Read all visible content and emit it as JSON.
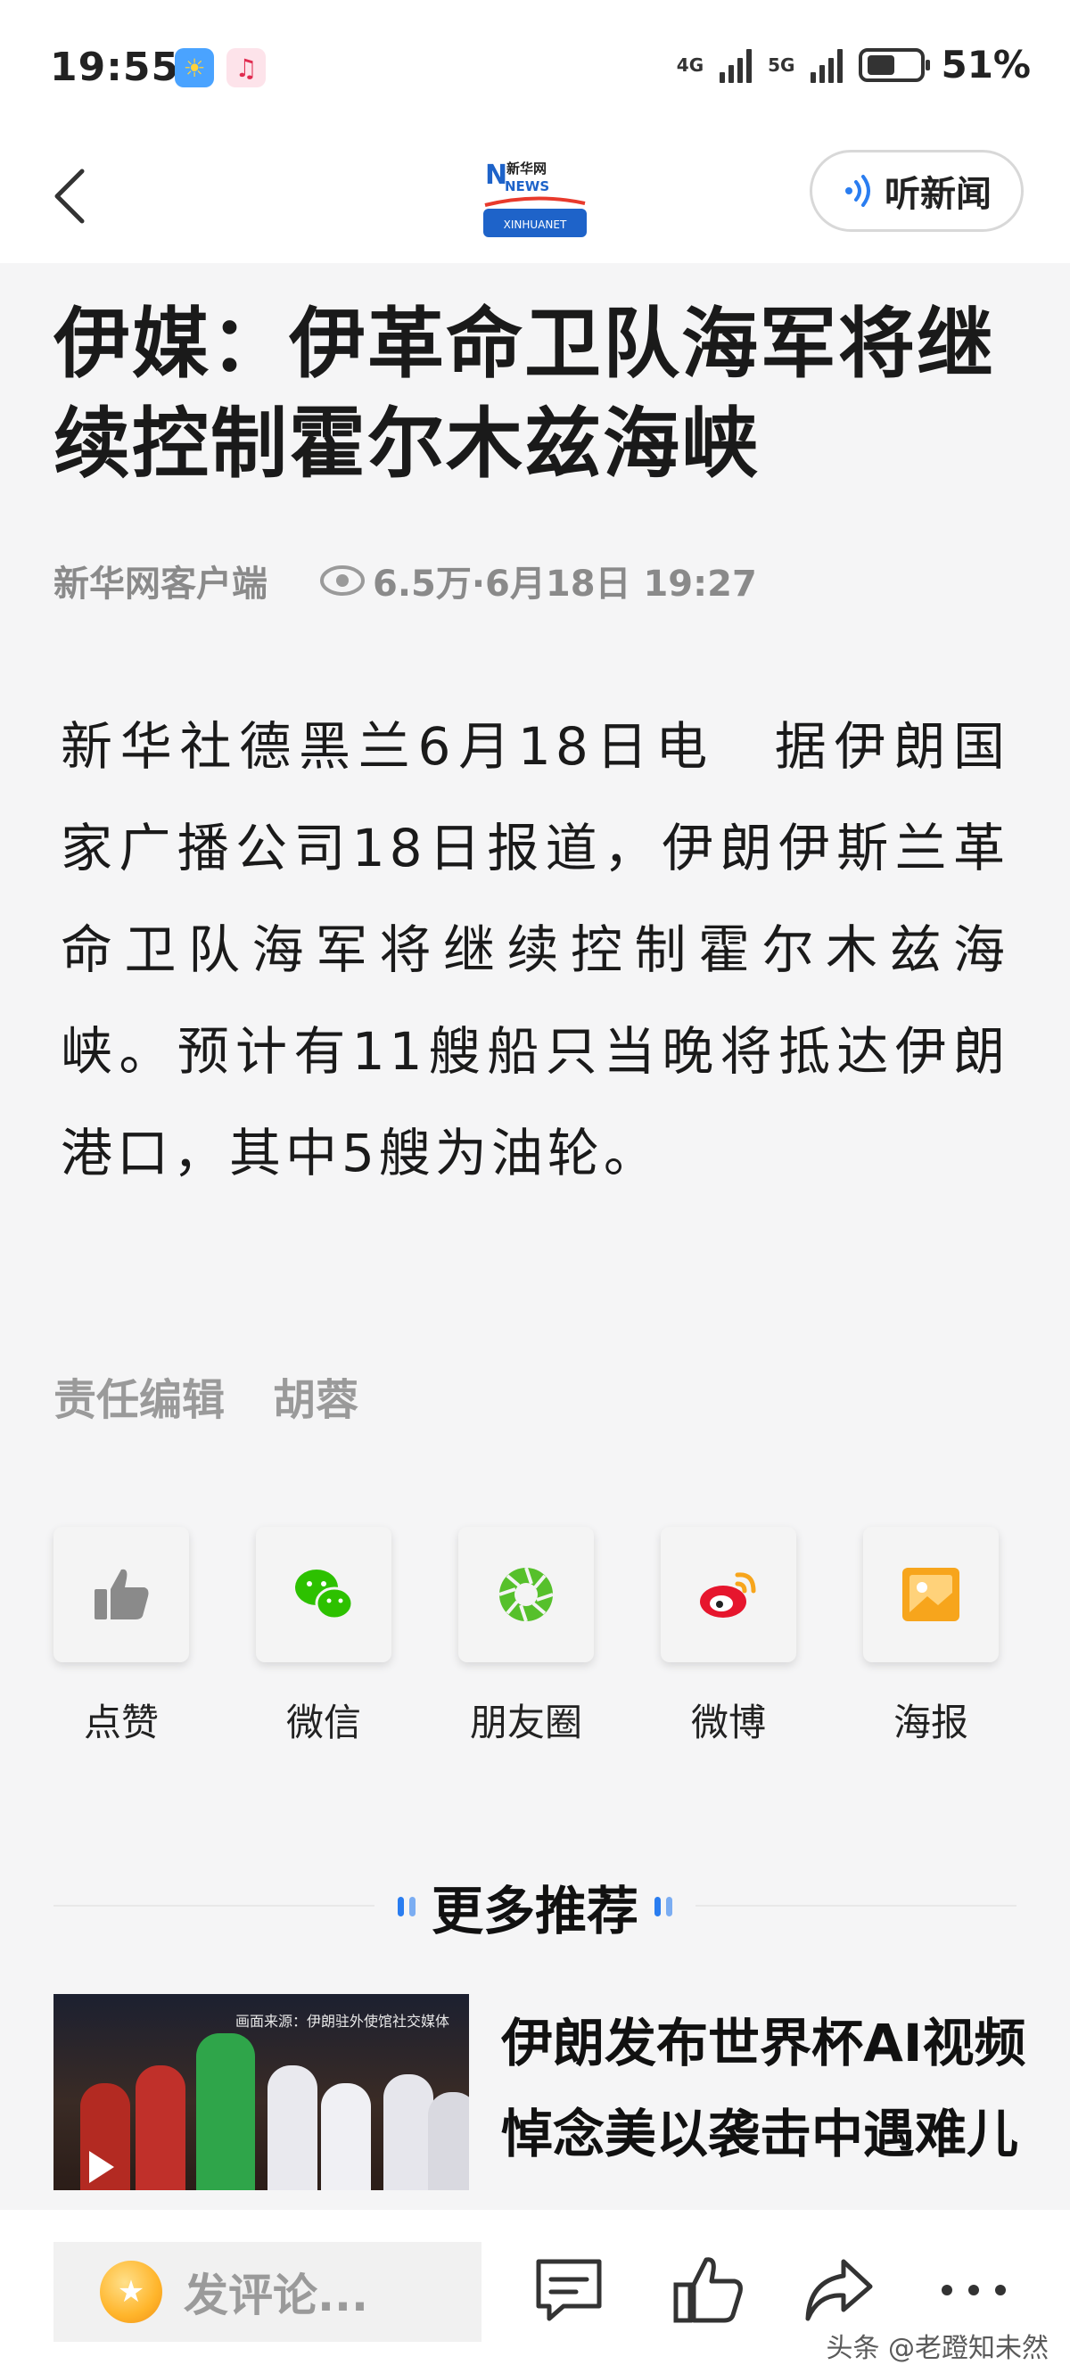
{
  "status_bar": {
    "time": "19:55",
    "network_1": "4G",
    "network_2": "5G",
    "battery": "51%",
    "icons": [
      "weather-icon",
      "music-icon",
      "signal-icon",
      "battery-icon"
    ]
  },
  "nav": {
    "logo_top": "新华网",
    "logo_mid": "NEWS",
    "logo_bottom": "XINHUANET",
    "listen_label": "听新闻"
  },
  "article": {
    "headline": "伊媒：伊革命卫队海军将继续控制霍尔木兹海峡",
    "source": "新华网客户端",
    "views_date": "6.5万·6月18日 19:27",
    "body": "新华社德黑兰6月18日电　据伊朗国家广播公司18日报道，伊朗伊斯兰革命卫队海军将继续控制霍尔木兹海峡。预计有11艘船只当晚将抵达伊朗港口，其中5艘为油轮。",
    "editor_label": "责任编辑",
    "editor_name": "胡蓉"
  },
  "share": [
    {
      "label": "点赞",
      "icon": "thumbs-up-icon"
    },
    {
      "label": "微信",
      "icon": "wechat-icon"
    },
    {
      "label": "朋友圈",
      "icon": "moments-icon"
    },
    {
      "label": "微博",
      "icon": "weibo-icon"
    },
    {
      "label": "海报",
      "icon": "poster-icon"
    }
  ],
  "more": {
    "title": "更多推荐",
    "items": [
      {
        "title": "伊朗发布世界杯AI视频 悼念美以袭击中遇难儿童",
        "thumb_caption": "画面来源：伊朗驻外使馆社交媒体"
      }
    ]
  },
  "bottom_bar": {
    "comment_placeholder": "发评论...",
    "icons": [
      "comment-icon",
      "like-icon",
      "share-icon",
      "more-icon"
    ]
  },
  "watermark": "头条 @老蹬知未然",
  "colors": {
    "accent_blue": "#2a7df0",
    "wechat_green": "#2dc100",
    "weibo_red": "#e6162d",
    "poster_orange": "#f7a51c",
    "meta_gray": "#8a8a8a"
  }
}
